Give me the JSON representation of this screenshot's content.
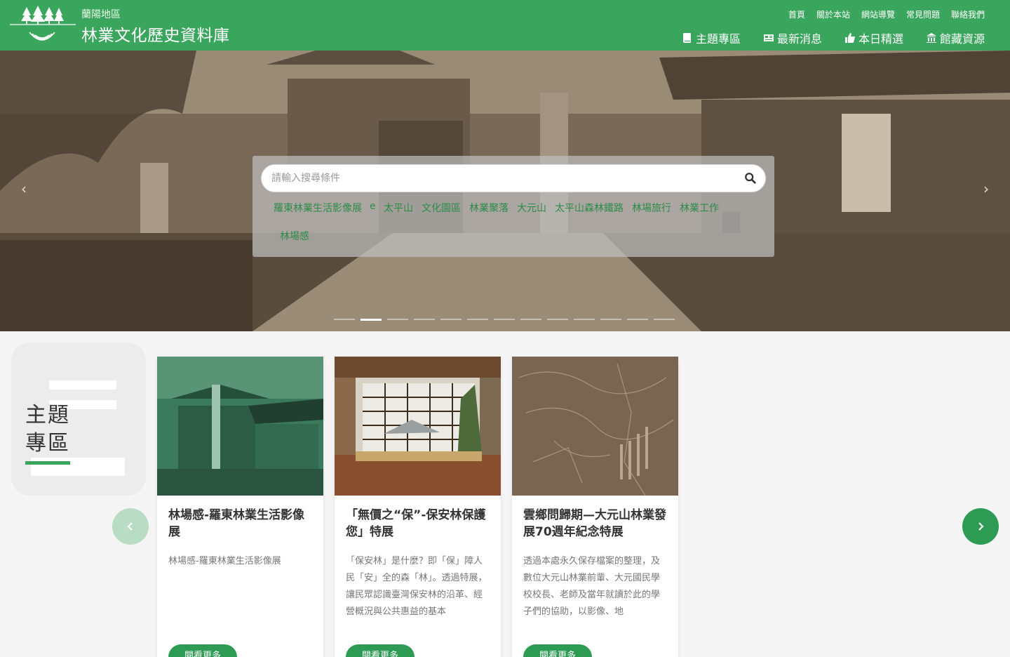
{
  "header": {
    "region": "蘭陽地區",
    "title": "林業文化歷史資料庫",
    "logo_caption": "蘭陽地區林業文化歷史資料庫",
    "top_links": [
      "首頁",
      "關於本站",
      "網站導覽",
      "常見問題",
      "聯絡我們"
    ],
    "nav": [
      {
        "label": "主題專區",
        "icon": "book-icon"
      },
      {
        "label": "最新消息",
        "icon": "newspaper-icon"
      },
      {
        "label": "本日精選",
        "icon": "thumbs-up-icon"
      },
      {
        "label": "館藏資源",
        "icon": "museum-icon"
      }
    ],
    "brand_color": "#3aa55c"
  },
  "hero": {
    "search_placeholder": "請輸入搜尋條件",
    "tags": [
      "羅東林業生活影像展",
      "e",
      "太平山",
      "文化園區",
      "林業聚落",
      "大元山",
      "太平山森林鐵路",
      "林場旅行",
      "林業工作",
      "林場感"
    ],
    "slide_count": 13,
    "active_slide": 2
  },
  "theme": {
    "label_line1": "主題",
    "label_line2": "專區",
    "cards": [
      {
        "title": "林場感-羅東林業生活影像展",
        "desc": "林場感-羅東林業生活影像展",
        "button": "閱看更多"
      },
      {
        "title": "「無價之“保”-保安林保護您」特展",
        "desc": "「保安林」是什麼？即「保」障人民「安」全的森「林」。透過特展，讓民眾認識臺灣保安林的沿革、經營概況與公共惠益的基本",
        "button": "閱看更多"
      },
      {
        "title": "雲鄉問歸期—大元山林業發展70週年紀念特展",
        "desc": "透過本處永久保存檔案的整理，及數位大元山林業前輩、大元國民學校校長、老師及當年就讀於此的學子們的協助，以影像、地",
        "button": "閱看更多"
      }
    ]
  }
}
